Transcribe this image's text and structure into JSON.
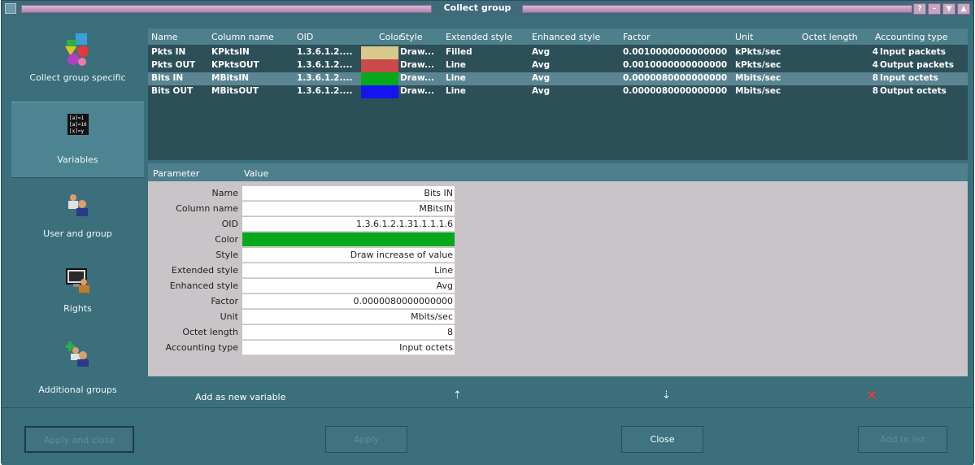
{
  "window": {
    "title": "Collect group"
  },
  "sidebar": {
    "items": [
      {
        "label": "Collect group specific",
        "icon": "shapes-icon"
      },
      {
        "label": "Variables",
        "icon": "formula-icon"
      },
      {
        "label": "User and group",
        "icon": "users-icon"
      },
      {
        "label": "Rights",
        "icon": "monitor-user-icon"
      },
      {
        "label": "Additional groups",
        "icon": "add-user-icon"
      }
    ]
  },
  "variables": {
    "headers": [
      "Name",
      "Column name",
      "OID",
      "Color",
      "Style",
      "Extended style",
      "Enhanced style",
      "Factor",
      "Unit",
      "Octet length",
      "Accounting type"
    ],
    "rows": [
      {
        "name": "Pkts IN",
        "column": "KPktsIN",
        "oid": "1.3.6.1.2....",
        "color": "#d8c88a",
        "style": "Draw...",
        "ext": "Filled",
        "enh": "Avg",
        "factor": "0.0010000000000000",
        "unit": "kPkts/sec",
        "octet": "4",
        "acct": "Input packets"
      },
      {
        "name": "Pkts OUT",
        "column": "KPktsOUT",
        "oid": "1.3.6.1.2....",
        "color": "#c84a4a",
        "style": "Draw...",
        "ext": "Line",
        "enh": "Avg",
        "factor": "0.0010000000000000",
        "unit": "kPkts/sec",
        "octet": "4",
        "acct": "Output packets"
      },
      {
        "name": "Bits IN",
        "column": "MBitsIN",
        "oid": "1.3.6.1.2....",
        "color": "#07a81b",
        "style": "Draw...",
        "ext": "Line",
        "enh": "Avg",
        "factor": "0.0000080000000000",
        "unit": "Mbits/sec",
        "octet": "8",
        "acct": "Input octets"
      },
      {
        "name": "Bits OUT",
        "column": "MBitsOUT",
        "oid": "1.3.6.1.2....",
        "color": "#1414f0",
        "style": "Draw...",
        "ext": "Line",
        "enh": "Avg",
        "factor": "0.0000080000000000",
        "unit": "Mbits/sec",
        "octet": "8",
        "acct": "Output octets"
      }
    ]
  },
  "parameters": {
    "headers": [
      "Parameter",
      "Value"
    ],
    "rows": [
      {
        "label": "Name",
        "value": "Bits IN"
      },
      {
        "label": "Column name",
        "value": "MBitsIN"
      },
      {
        "label": "OID",
        "value": "1.3.6.1.2.1.31.1.1.1.6"
      },
      {
        "label": "Color",
        "value": ""
      },
      {
        "label": "Style",
        "value": "Draw increase of value"
      },
      {
        "label": "Extended style",
        "value": "Line"
      },
      {
        "label": "Enhanced style",
        "value": "Avg"
      },
      {
        "label": "Factor",
        "value": "0.0000080000000000"
      },
      {
        "label": "Unit",
        "value": "Mbits/sec"
      },
      {
        "label": "Octet length",
        "value": "8"
      },
      {
        "label": "Accounting type",
        "value": "Input octets"
      }
    ],
    "selected_color": "#07a81b"
  },
  "actions": {
    "add_new": "Add as new variable"
  },
  "buttons": {
    "apply_close": "Apply and close",
    "apply": "Apply",
    "close": "Close",
    "add_to_list": "Add to list"
  }
}
